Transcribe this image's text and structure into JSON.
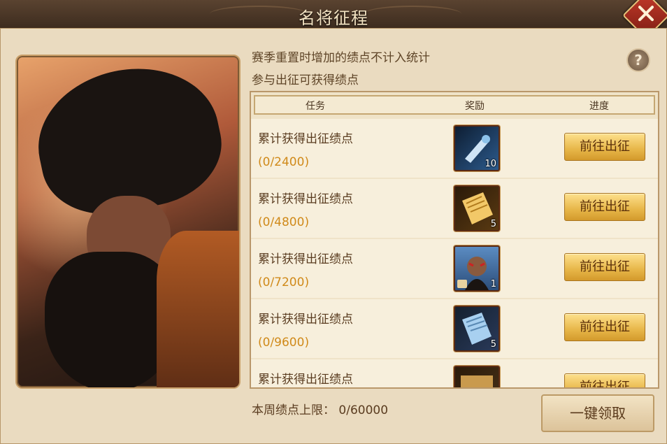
{
  "title": "名将征程",
  "info_lines": [
    "赛季重置时增加的绩点不计入统计",
    "参与出征可获得绩点"
  ],
  "help_label": "?",
  "table": {
    "headers": [
      "任务",
      "奖励",
      "进度"
    ],
    "rows": [
      {
        "task": "累计获得出征绩点",
        "progress": "(0/2400)",
        "reward_icon": "scroll-bundle-icon",
        "quantity": "10",
        "button": "前往出征",
        "icon_color": "#2c5a8c"
      },
      {
        "task": "累计获得出征绩点",
        "progress": "(0/4800)",
        "reward_icon": "gold-scroll-icon",
        "quantity": "5",
        "button": "前往出征",
        "icon_color": "#5a3a12"
      },
      {
        "task": "累计获得出征绩点",
        "progress": "(0/7200)",
        "reward_icon": "general-portrait-icon",
        "quantity": "1",
        "button": "前往出征",
        "icon_color": "#3a6a9a"
      },
      {
        "task": "累计获得出征绩点",
        "progress": "(0/9600)",
        "reward_icon": "blue-scroll-icon",
        "quantity": "5",
        "button": "前往出征",
        "icon_color": "#2a3a5a"
      },
      {
        "task": "累计获得出征绩点",
        "progress": "",
        "reward_icon": "map-scroll-icon",
        "quantity": "",
        "button": "前往出征",
        "icon_color": "#4a3218"
      }
    ]
  },
  "weekly_limit": "本周绩点上限： 0/60000",
  "claim_all_button": "一键领取"
}
